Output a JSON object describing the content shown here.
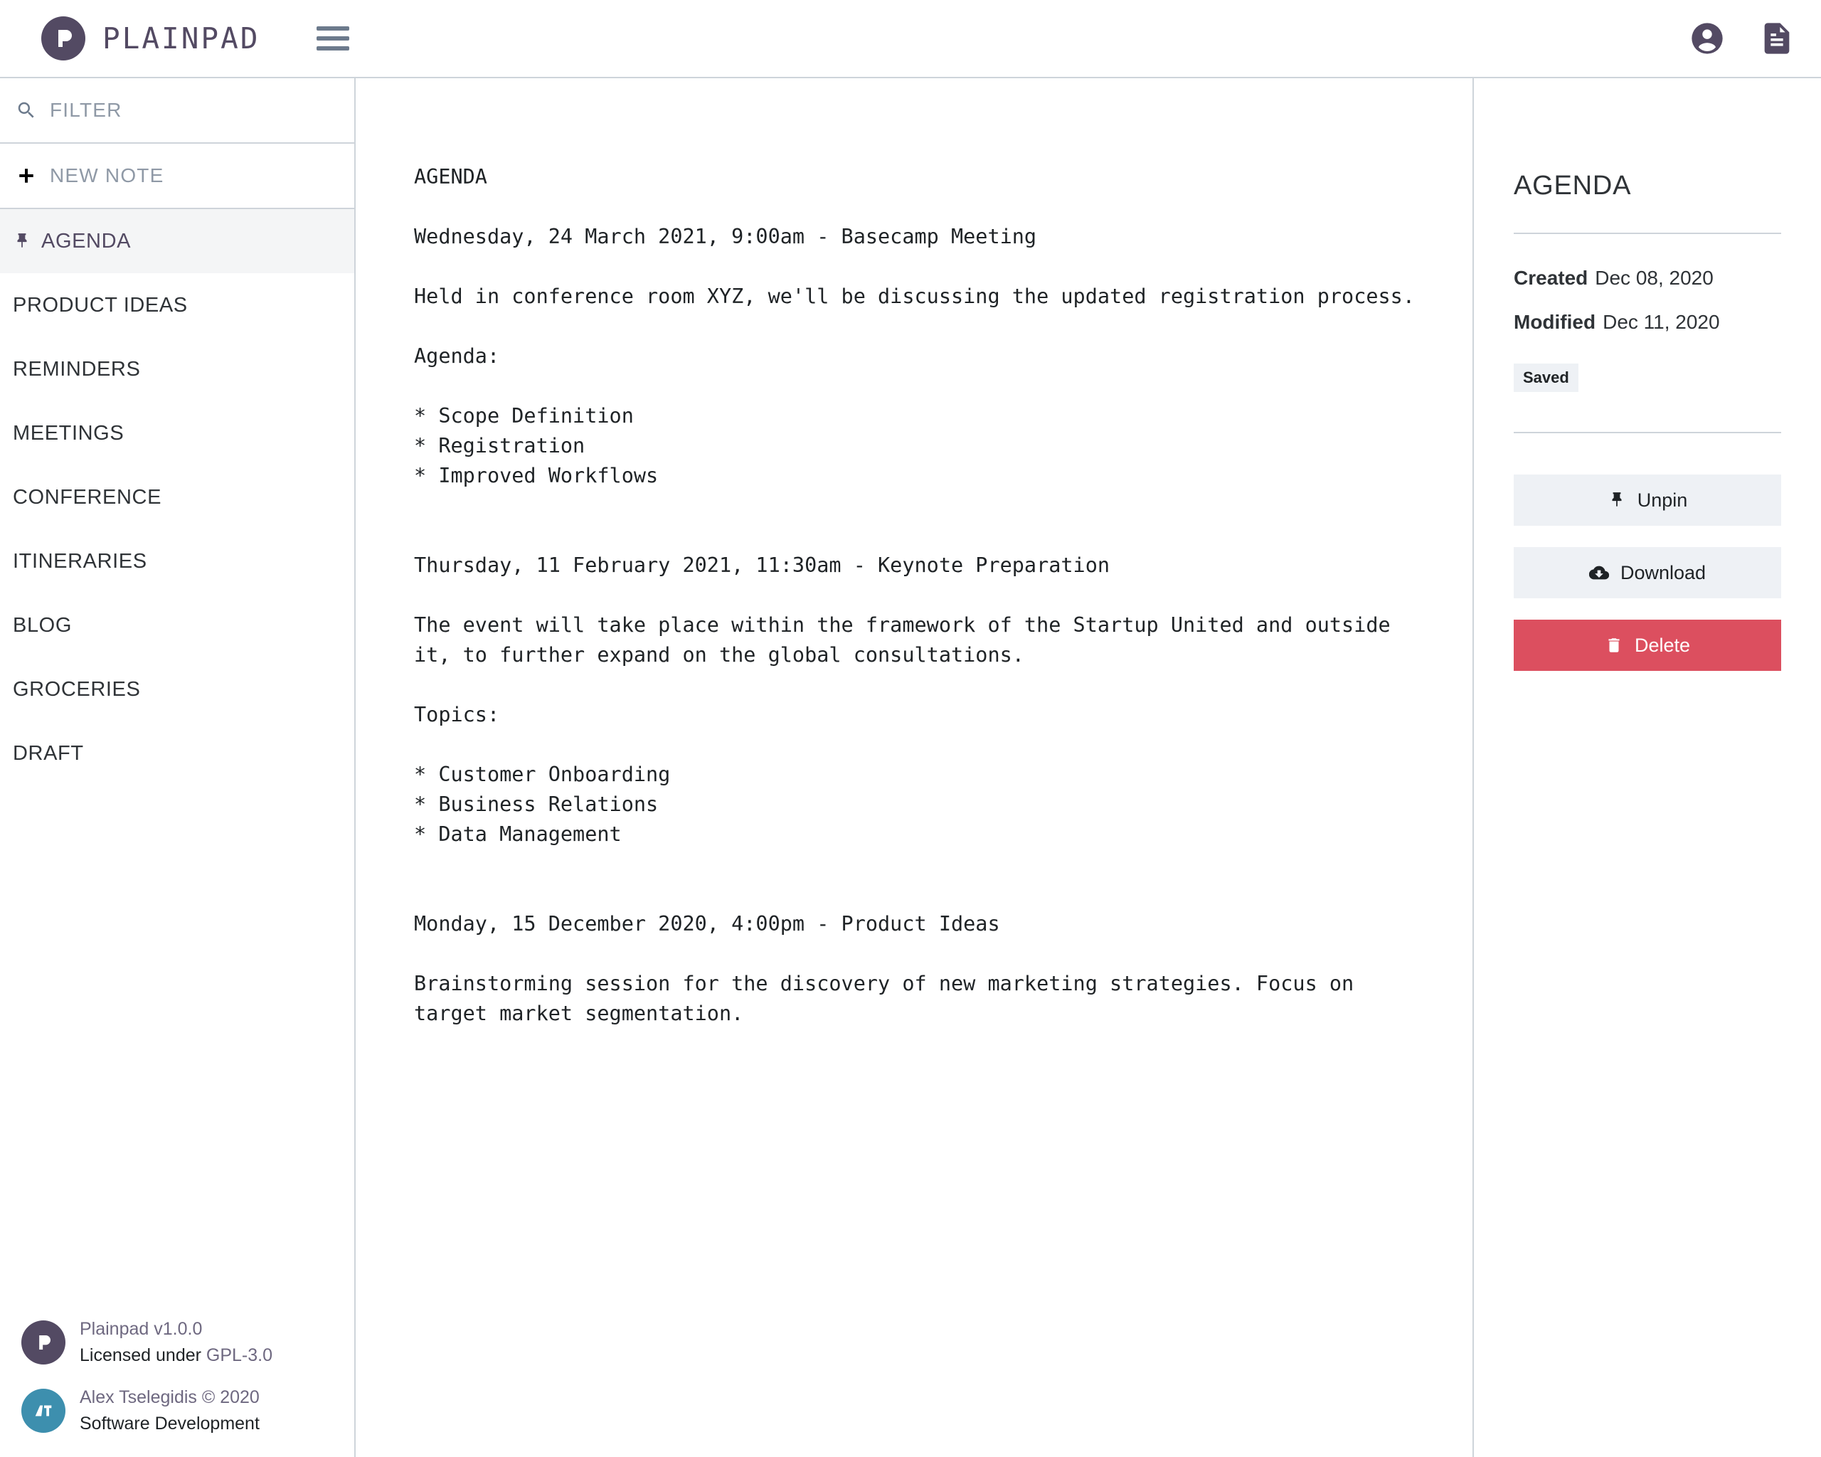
{
  "header": {
    "brand_name": "PLAINPAD",
    "menu_icon": "hamburger-icon",
    "account_icon": "account-circle-icon",
    "notes_icon": "document-icon"
  },
  "sidebar": {
    "filter": {
      "label": "FILTER",
      "placeholder": "FILTER",
      "icon": "search-icon"
    },
    "new_note": {
      "label": "NEW NOTE",
      "icon": "plus-icon"
    },
    "notes": [
      {
        "label": "AGENDA",
        "pinned": true,
        "active": true,
        "icon": "pin-icon"
      },
      {
        "label": "PRODUCT IDEAS",
        "pinned": false,
        "active": false
      },
      {
        "label": "REMINDERS",
        "pinned": false,
        "active": false
      },
      {
        "label": "MEETINGS",
        "pinned": false,
        "active": false
      },
      {
        "label": "CONFERENCE",
        "pinned": false,
        "active": false
      },
      {
        "label": "ITINERARIES",
        "pinned": false,
        "active": false
      },
      {
        "label": "BLOG",
        "pinned": false,
        "active": false
      },
      {
        "label": "GROCERIES",
        "pinned": false,
        "active": false
      },
      {
        "label": "DRAFT",
        "pinned": false,
        "active": false
      }
    ],
    "footer": {
      "app_line1": "Plainpad v1.0.0",
      "app_line2_prefix": "Licensed under ",
      "app_license": "GPL-3.0",
      "author_line1": "Alex Tselegidis © 2020",
      "author_line2": "Software Development",
      "app_avatar_initial": "P",
      "author_avatar_initials": "AT"
    }
  },
  "editor": {
    "content": "AGENDA\n\nWednesday, 24 March 2021, 9:00am - Basecamp Meeting\n\nHeld in conference room XYZ, we'll be discussing the updated registration process.\n\nAgenda:\n\n* Scope Definition\n* Registration\n* Improved Workflows\n\n\nThursday, 11 February 2021, 11:30am - Keynote Preparation\n\nThe event will take place within the framework of the Startup United and outside it, to further expand on the global consultations.\n\nTopics:\n\n* Customer Onboarding\n* Business Relations\n* Data Management\n\n\nMonday, 15 December 2020, 4:00pm - Product Ideas\n\nBrainstorming session for the discovery of new marketing strategies. Focus on target market segmentation."
  },
  "details": {
    "title": "AGENDA",
    "created_label": "Created",
    "created_value": "Dec 08, 2020",
    "modified_label": "Modified",
    "modified_value": "Dec 11, 2020",
    "status_badge": "Saved",
    "actions": {
      "unpin_label": "Unpin",
      "unpin_icon": "pin-icon",
      "download_label": "Download",
      "download_icon": "cloud-download-icon",
      "delete_label": "Delete",
      "delete_icon": "trash-icon"
    }
  },
  "colors": {
    "brand_purple": "#534a63",
    "slate": "#6c7a8c",
    "danger_red": "#dc4f5f",
    "border": "#ced4da",
    "button_bg": "#eef1f5",
    "author_teal": "#3d8fae"
  }
}
